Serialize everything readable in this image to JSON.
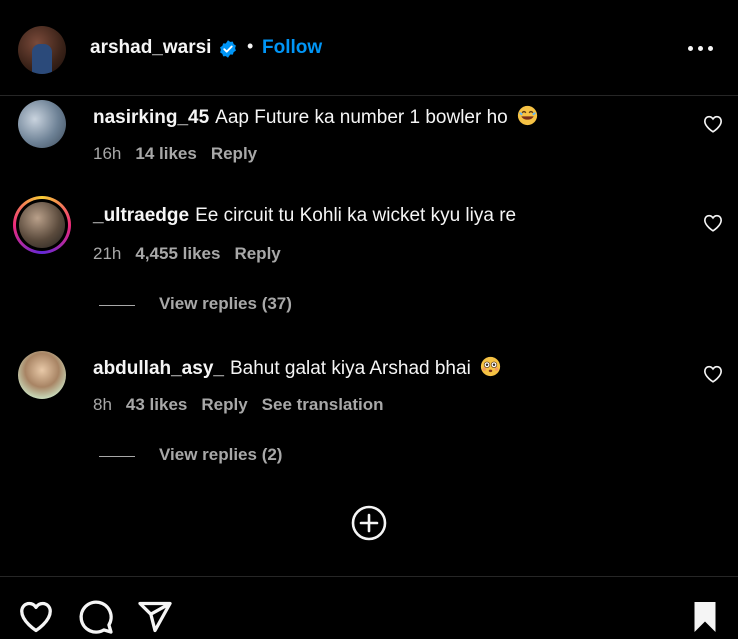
{
  "header": {
    "username": "arshad_warsi",
    "separator": "•",
    "follow_label": "Follow"
  },
  "comments": [
    {
      "username": "nasirking_45",
      "text": "Aap Future ka number 1 bowler ho",
      "emoji": "rolling-on-floor-laughing-emoji",
      "time": "16h",
      "likes": "14 likes",
      "reply": "Reply"
    },
    {
      "username": "_ultraedge",
      "text": "Ee circuit tu Kohli ka wicket kyu liya re",
      "time": "21h",
      "likes": "4,455 likes",
      "reply": "Reply",
      "view_replies": "View replies (37)"
    },
    {
      "username": "abdullah_asy_",
      "text": "Bahut galat kiya Arshad bhai",
      "emoji": "flushed-face-emoji",
      "time": "8h",
      "likes": "43 likes",
      "reply": "Reply",
      "translation": "See translation",
      "view_replies": "View replies (2)"
    }
  ],
  "icons": [
    "verified-badge-icon",
    "more-options-icon",
    "heart-icon",
    "plus-circle-icon",
    "like-icon",
    "comment-icon",
    "share-icon",
    "bookmark-icon"
  ],
  "colors": {
    "accent": "#0095f6",
    "background": "#000000",
    "muted": "#a8a8a8",
    "story_ring_start": "#f9ce34",
    "story_ring_end": "#ee2a7b"
  }
}
